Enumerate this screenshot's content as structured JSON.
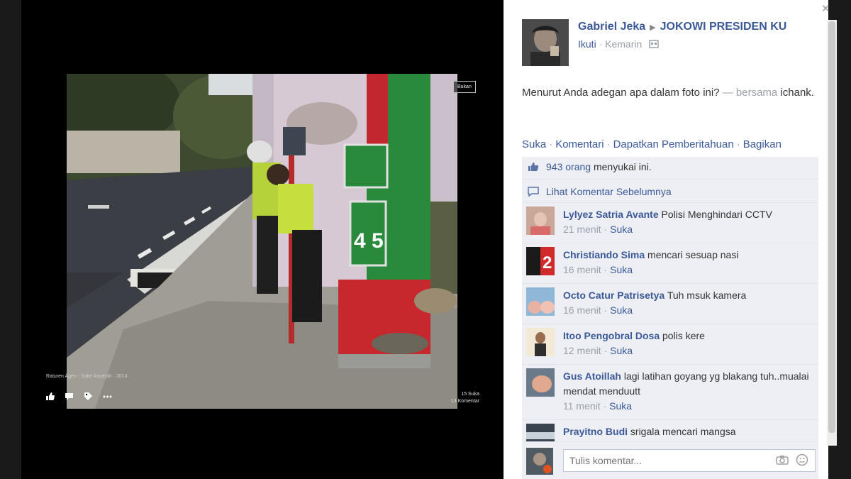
{
  "photo": {
    "tag_label": "Bukan",
    "caption": "Raturen Agen - Sake Asuerah · 2014",
    "stats_likes": "15 Suka",
    "stats_comments": "13 Komentar"
  },
  "post": {
    "author": "Gabriel Jeka",
    "group": "JOKOWI PRESIDEN KU",
    "follow": "Ikuti",
    "time": "Kemarin",
    "text": "Menurut Anda adegan apa dalam foto ini?",
    "with_text": "— bersama",
    "tagged": "ichank."
  },
  "actions": {
    "like": "Suka",
    "comment": "Komentari",
    "notify": "Dapatkan Pemberitahuan",
    "share": "Bagikan"
  },
  "likes": {
    "count": "943 orang",
    "suffix": "menyukai ini."
  },
  "prev_comments": "Lihat Komentar Sebelumnya",
  "comments": [
    {
      "name": "Lylyez Satria Avante",
      "text": "Polisi Menghindari CCTV",
      "time": "21 menit",
      "like": "Suka"
    },
    {
      "name": "Christiando Sima",
      "text": "mencari sesuap nasi",
      "time": "16 menit",
      "like": "Suka"
    },
    {
      "name": "Octo Catur Patrisetya",
      "text": "Tuh msuk kamera",
      "time": "16 menit",
      "like": "Suka"
    },
    {
      "name": "Itoo Pengobral Dosa",
      "text": "polis kere",
      "time": "12 menit",
      "like": "Suka"
    },
    {
      "name": "Gus Atoillah",
      "text": "lagi latihan goyang yg blakang tuh..mualai mendat menduutt",
      "time": "11 menit",
      "like": "Suka"
    },
    {
      "name": "Prayitno Budi",
      "text": "srigala mencari mangsa",
      "time": "",
      "like": ""
    }
  ],
  "input": {
    "placeholder": "Tulis komentar..."
  },
  "colors": {
    "link": "#3b5998",
    "muted": "#9aa0aa",
    "comments_bg": "#edeff4"
  }
}
